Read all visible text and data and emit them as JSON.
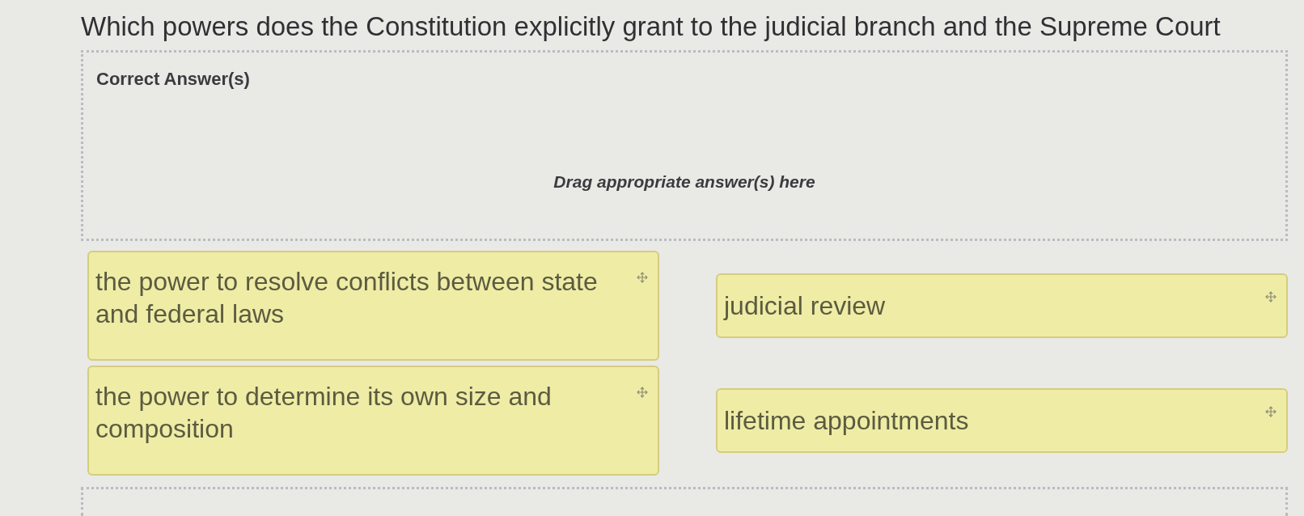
{
  "question": {
    "text": "Which powers does the Constitution explicitly grant to the judicial branch and the Supreme Court"
  },
  "answer_zone": {
    "title": "Correct Answer(s)",
    "placeholder": "Drag appropriate answer(s) here"
  },
  "answer_choices": [
    {
      "text": "the power to resolve conflicts between state and federal laws"
    },
    {
      "text": "judicial review"
    },
    {
      "text": "the power to determine its own size and composition"
    },
    {
      "text": "lifetime appointments"
    }
  ]
}
